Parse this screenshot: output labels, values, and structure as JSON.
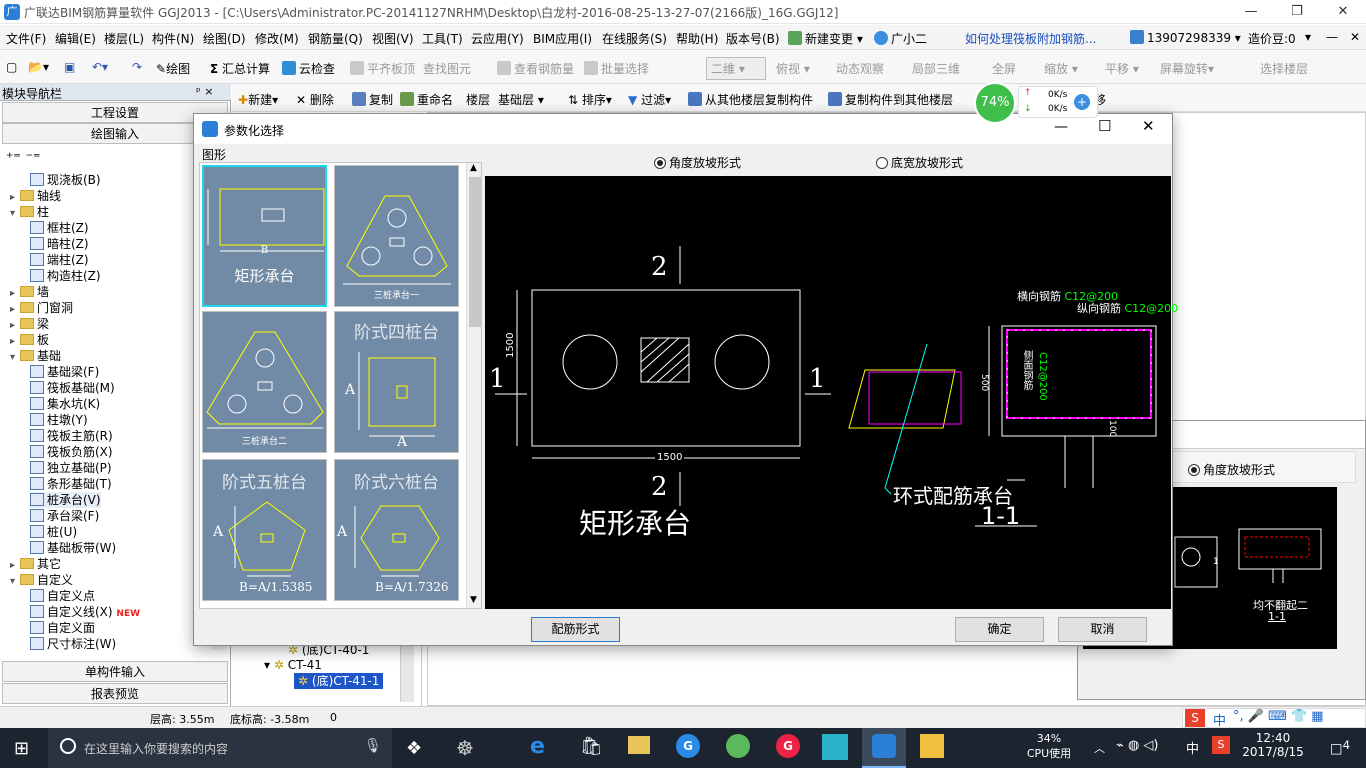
{
  "window": {
    "title": "广联达BIM钢筋算量软件 GGJ2013 - [C:\\Users\\Administrator.PC-20141127NRHM\\Desktop\\白龙村-2016-08-25-13-27-07(2166版)_16G.GGJ12]",
    "minimize": "—",
    "restore": "❐",
    "close": "✕"
  },
  "menu": {
    "items": [
      "文件(F)",
      "编辑(E)",
      "楼层(L)",
      "构件(N)",
      "绘图(D)",
      "修改(M)",
      "钢筋量(Q)",
      "视图(V)",
      "工具(T)",
      "云应用(Y)",
      "BIM应用(I)",
      "在线服务(S)",
      "帮助(H)",
      "版本号(B)"
    ],
    "new_change": "新建变更",
    "assistant": "广小二",
    "link": "如何处理筏板附加钢筋...",
    "phone": "13907298339",
    "price_bean": "造价豆:0"
  },
  "toolbar1": {
    "items": [
      "绘图",
      "汇总计算",
      "云检查",
      "平齐板顶",
      "查找图元",
      "查看钢筋量",
      "批量选择",
      "二维",
      "俯视",
      "动态观察",
      "局部三维",
      "全屏",
      "缩放",
      "平移",
      "屏幕旋转",
      "选择楼层"
    ]
  },
  "toolbar2": {
    "items": [
      "新建",
      "删除",
      "复制",
      "重命名",
      "楼层",
      "基础层",
      "排序",
      "过滤",
      "从其他楼层复制构件",
      "复制构件到其他楼层",
      "移"
    ]
  },
  "net": {
    "percent": "74%",
    "up": "0K/s",
    "down": "0K/s"
  },
  "leftpanel": {
    "title": "模块导航栏",
    "pin": "ᵖ ×",
    "project_settings": "工程设置",
    "drawing_input": "绘图输入",
    "tree": [
      {
        "label": "现浇板(B)",
        "level": 2,
        "type": "item"
      },
      {
        "label": "轴线",
        "level": 1,
        "type": "folder",
        "exp": "+"
      },
      {
        "label": "柱",
        "level": 1,
        "type": "folder",
        "exp": "-"
      },
      {
        "label": "框柱(Z)",
        "level": 2,
        "type": "item"
      },
      {
        "label": "暗柱(Z)",
        "level": 2,
        "type": "item"
      },
      {
        "label": "端柱(Z)",
        "level": 2,
        "type": "item"
      },
      {
        "label": "构造柱(Z)",
        "level": 2,
        "type": "item"
      },
      {
        "label": "墙",
        "level": 1,
        "type": "folder",
        "exp": "+"
      },
      {
        "label": "门窗洞",
        "level": 1,
        "type": "folder",
        "exp": "+"
      },
      {
        "label": "梁",
        "level": 1,
        "type": "folder",
        "exp": "+"
      },
      {
        "label": "板",
        "level": 1,
        "type": "folder",
        "exp": "+"
      },
      {
        "label": "基础",
        "level": 1,
        "type": "folder",
        "exp": "-"
      },
      {
        "label": "基础梁(F)",
        "level": 2,
        "type": "item"
      },
      {
        "label": "筏板基础(M)",
        "level": 2,
        "type": "item"
      },
      {
        "label": "集水坑(K)",
        "level": 2,
        "type": "item"
      },
      {
        "label": "柱墩(Y)",
        "level": 2,
        "type": "item"
      },
      {
        "label": "筏板主筋(R)",
        "level": 2,
        "type": "item"
      },
      {
        "label": "筏板负筋(X)",
        "level": 2,
        "type": "item"
      },
      {
        "label": "独立基础(P)",
        "level": 2,
        "type": "item"
      },
      {
        "label": "条形基础(T)",
        "level": 2,
        "type": "item"
      },
      {
        "label": "桩承台(V)",
        "level": 2,
        "type": "item",
        "selected": true
      },
      {
        "label": "承台梁(F)",
        "level": 2,
        "type": "item"
      },
      {
        "label": "桩(U)",
        "level": 2,
        "type": "item"
      },
      {
        "label": "基础板带(W)",
        "level": 2,
        "type": "item"
      },
      {
        "label": "其它",
        "level": 1,
        "type": "folder",
        "exp": "+"
      },
      {
        "label": "自定义",
        "level": 1,
        "type": "folder",
        "exp": "-"
      },
      {
        "label": "自定义点",
        "level": 2,
        "type": "item"
      },
      {
        "label": "自定义线(X)",
        "level": 2,
        "type": "item",
        "badge": "NEW"
      },
      {
        "label": "自定义面",
        "level": 2,
        "type": "item"
      },
      {
        "label": "尺寸标注(W)",
        "level": 2,
        "type": "item"
      }
    ],
    "single_input": "单构件输入",
    "report": "报表预览"
  },
  "component_list": {
    "items": [
      "(底)CT-40-1",
      "CT-41",
      "(底)CT-41-1"
    ]
  },
  "status": {
    "floor_height": "层高: 3.55m",
    "base_elev": "底标高: -3.58m",
    "value": "0"
  },
  "dialog": {
    "title": "参数化选择",
    "group_label": "图形",
    "radio1": "角度放坡形式",
    "radio2": "底宽放坡形式",
    "thumbs": [
      {
        "label": "矩形承台",
        "sub": "B"
      },
      {
        "label": "三桩承台一",
        "sub": ""
      },
      {
        "label": "三桩承台二",
        "sub": ""
      },
      {
        "label": "阶式四桩台",
        "sub": "A"
      },
      {
        "label": "阶式五桩台",
        "sub": "B=A/1.5385"
      },
      {
        "label": "阶式六桩台",
        "sub": "B=A/1.7326"
      }
    ],
    "preview": {
      "sec2_top": "2",
      "sec2_bottom": "2",
      "sec1_left": "1",
      "sec1_right": "1",
      "dim_h": "1500",
      "dim_w": "1500",
      "main_label": "矩形承台",
      "ring_label": "环式配筋承台",
      "section_label": "1-1",
      "horiz_bar": "横向钢筋",
      "horiz_spec": "C12@200",
      "long_bar": "纵向钢筋",
      "long_spec": "C12@200",
      "side_bar": "侧面钢筋",
      "side_spec": "C12@200",
      "dim_500": "500",
      "dim_100": "100"
    },
    "rebar_btn": "配筋形式",
    "ok": "确定",
    "cancel": "取消"
  },
  "bgwin": {
    "radio": "角度放坡形式",
    "label1": "均不翻起二",
    "label2": "1-1"
  },
  "taskbar": {
    "search_placeholder": "在这里输入你要搜索的内容",
    "cpu_pct": "34%",
    "cpu_label": "CPU使用",
    "ime": "中",
    "time": "12:40",
    "date": "2017/8/15",
    "notif": "4"
  },
  "ime_bar": {
    "label": "中"
  }
}
